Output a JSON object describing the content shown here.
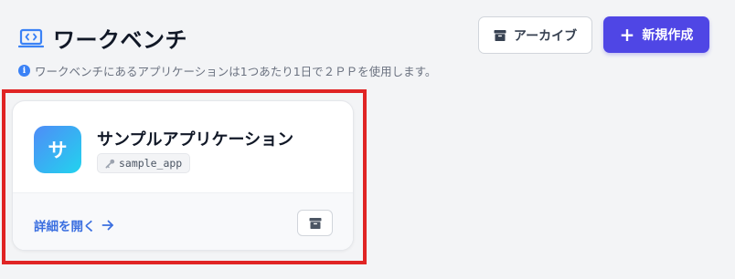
{
  "header": {
    "title": "ワークベンチ",
    "title_icon": "code-window-icon",
    "info": "ワークベンチにあるアプリケーションは1つあたり1日で２ＰＰを使用します。",
    "archive_button": "アーカイブ",
    "new_button": "新規作成"
  },
  "app_card": {
    "avatar_letter": "サ",
    "name": "サンプルアプリケーション",
    "id": "sample_app",
    "detail_link": "詳細を開く"
  },
  "colors": {
    "primary": "#4f46e5",
    "link": "#3b6fe0",
    "highlight": "#e02424",
    "avatar_gradient_start": "#4f8cf7",
    "avatar_gradient_end": "#22d3ee"
  }
}
